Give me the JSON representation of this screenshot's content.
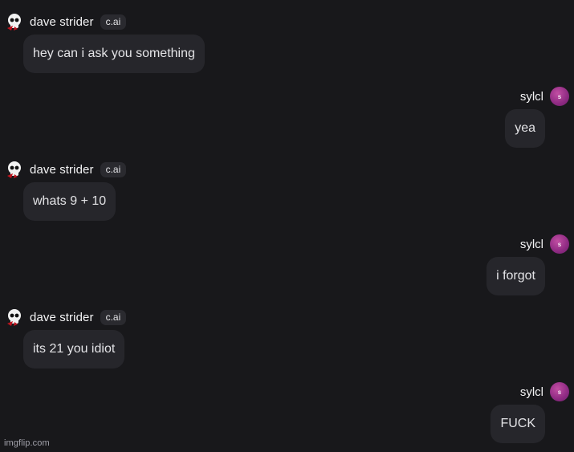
{
  "bot": {
    "name": "dave strider",
    "badge": "c.ai",
    "avatar_icon": "skull-icon"
  },
  "user": {
    "name": "sylcl",
    "avatar_letter": "s",
    "avatar_color": "#a33592"
  },
  "messages": [
    {
      "sender": "bot",
      "text": "hey can i ask you something"
    },
    {
      "sender": "user",
      "text": "yea"
    },
    {
      "sender": "bot",
      "text": "whats 9 + 10"
    },
    {
      "sender": "user",
      "text": "i forgot"
    },
    {
      "sender": "bot",
      "text": "its 21 you idiot"
    },
    {
      "sender": "user",
      "text": "FUCK"
    }
  ],
  "watermark": "imgflip.com",
  "colors": {
    "background": "#18181b",
    "bubble": "#26262b",
    "text": "#e4e4e7"
  }
}
